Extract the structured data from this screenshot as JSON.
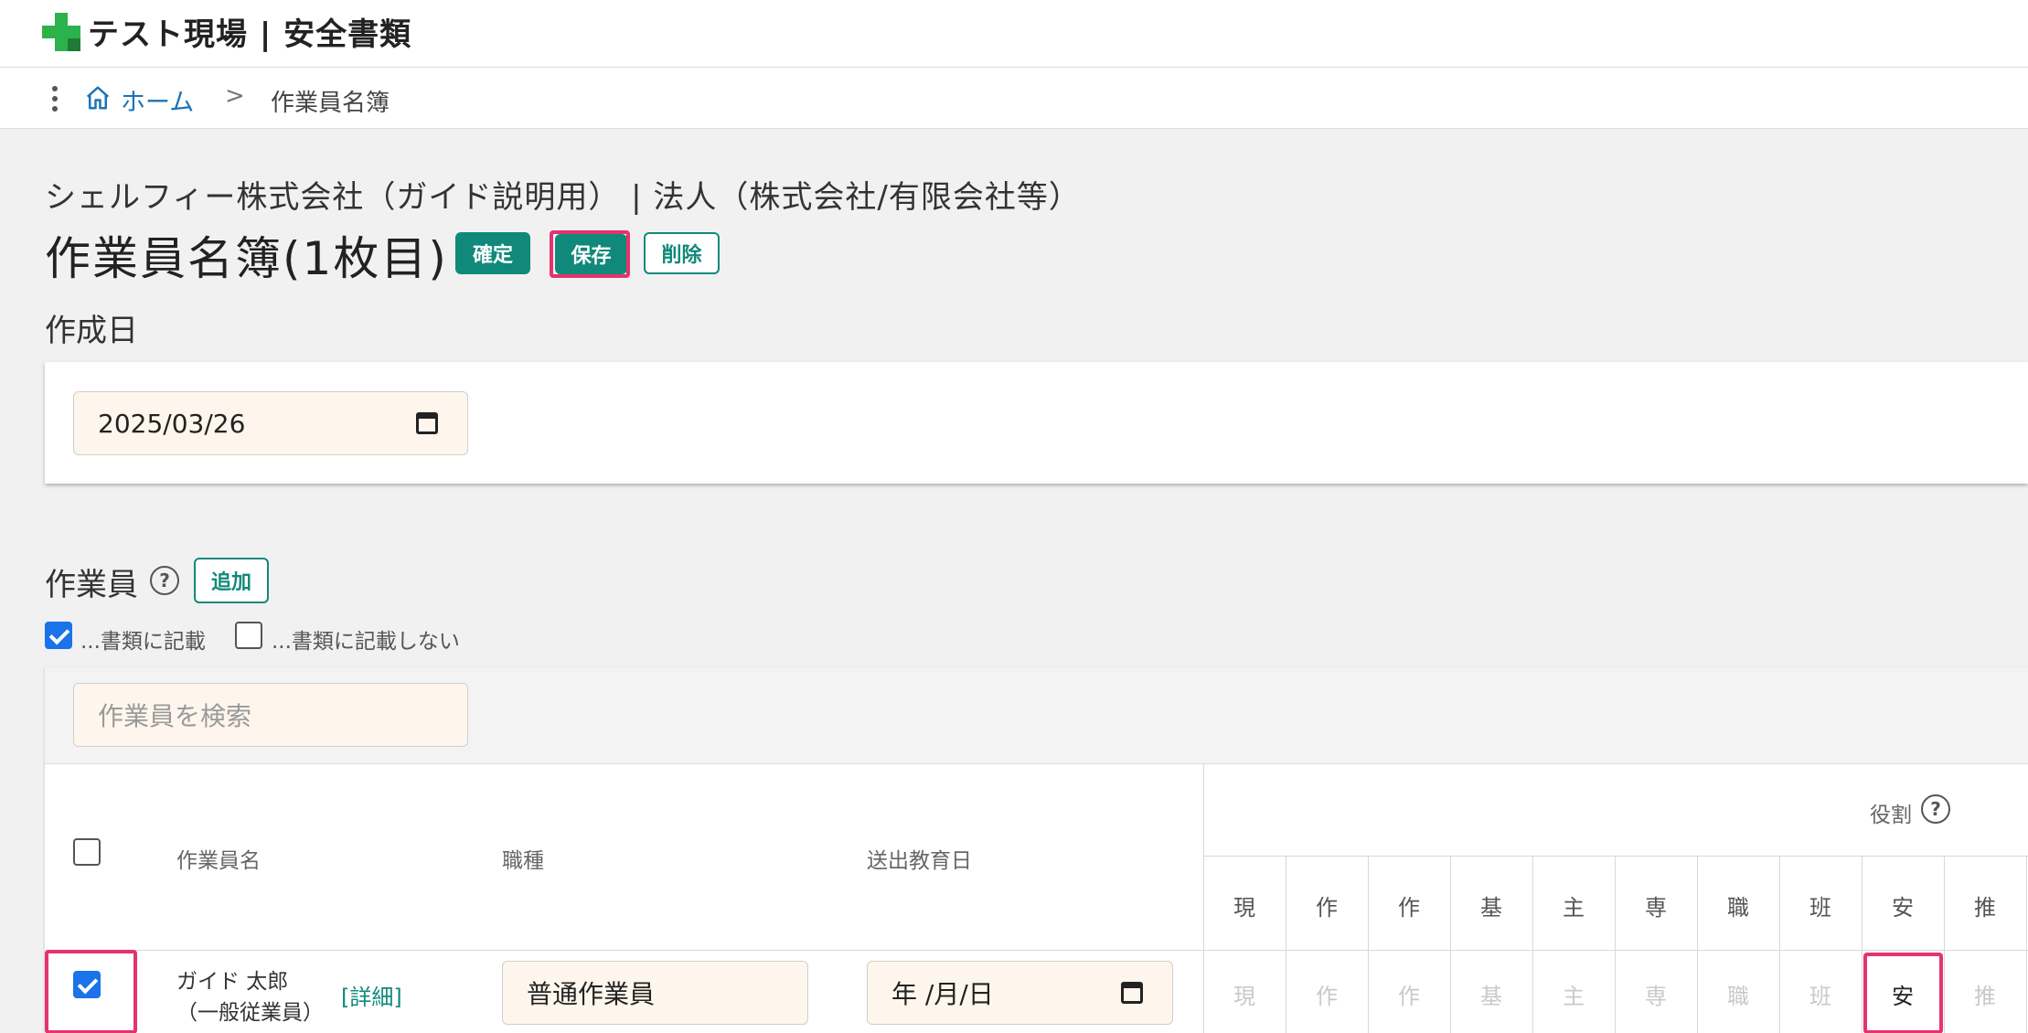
{
  "header": {
    "site_title": "テスト現場 | 安全書類",
    "brand_color": "#2bb24c"
  },
  "breadcrumb": {
    "home_label": "ホーム",
    "separator": ">",
    "current": "作業員名簿"
  },
  "document": {
    "company": "シェルフィー株式会社（ガイド説明用） | 法人（株式会社/有限会社等）",
    "title": "作業員名簿(1枚目)",
    "buttons": {
      "confirm": "確定",
      "save": "保存",
      "delete": "削除"
    },
    "accent_color": "#10897a",
    "highlight_color": "#e4336f"
  },
  "created_date": {
    "label": "作成日",
    "value": "2025/03/26"
  },
  "workers": {
    "label": "作業員",
    "add_button": "追加",
    "filters": [
      {
        "label": "...書類に記載",
        "checked": true
      },
      {
        "label": "...書類に記載しない",
        "checked": false
      }
    ],
    "search_placeholder": "作業員を検索",
    "columns": {
      "name": "作業員名",
      "job": "職種",
      "education_date": "送出教育日",
      "roles": "役割"
    },
    "role_headers": [
      "現",
      "作",
      "作",
      "基",
      "主",
      "専",
      "職",
      "班",
      "安",
      "推"
    ],
    "rows": [
      {
        "checked": true,
        "name": "ガイド 太郎",
        "type": "（一般従業員）",
        "detail": "[詳細]",
        "job": "普通作業員",
        "education_date": "年 /月/日",
        "roles": [
          "現",
          "作",
          "作",
          "基",
          "主",
          "専",
          "職",
          "班",
          "安",
          "推"
        ],
        "active_role_index": 8
      }
    ]
  }
}
